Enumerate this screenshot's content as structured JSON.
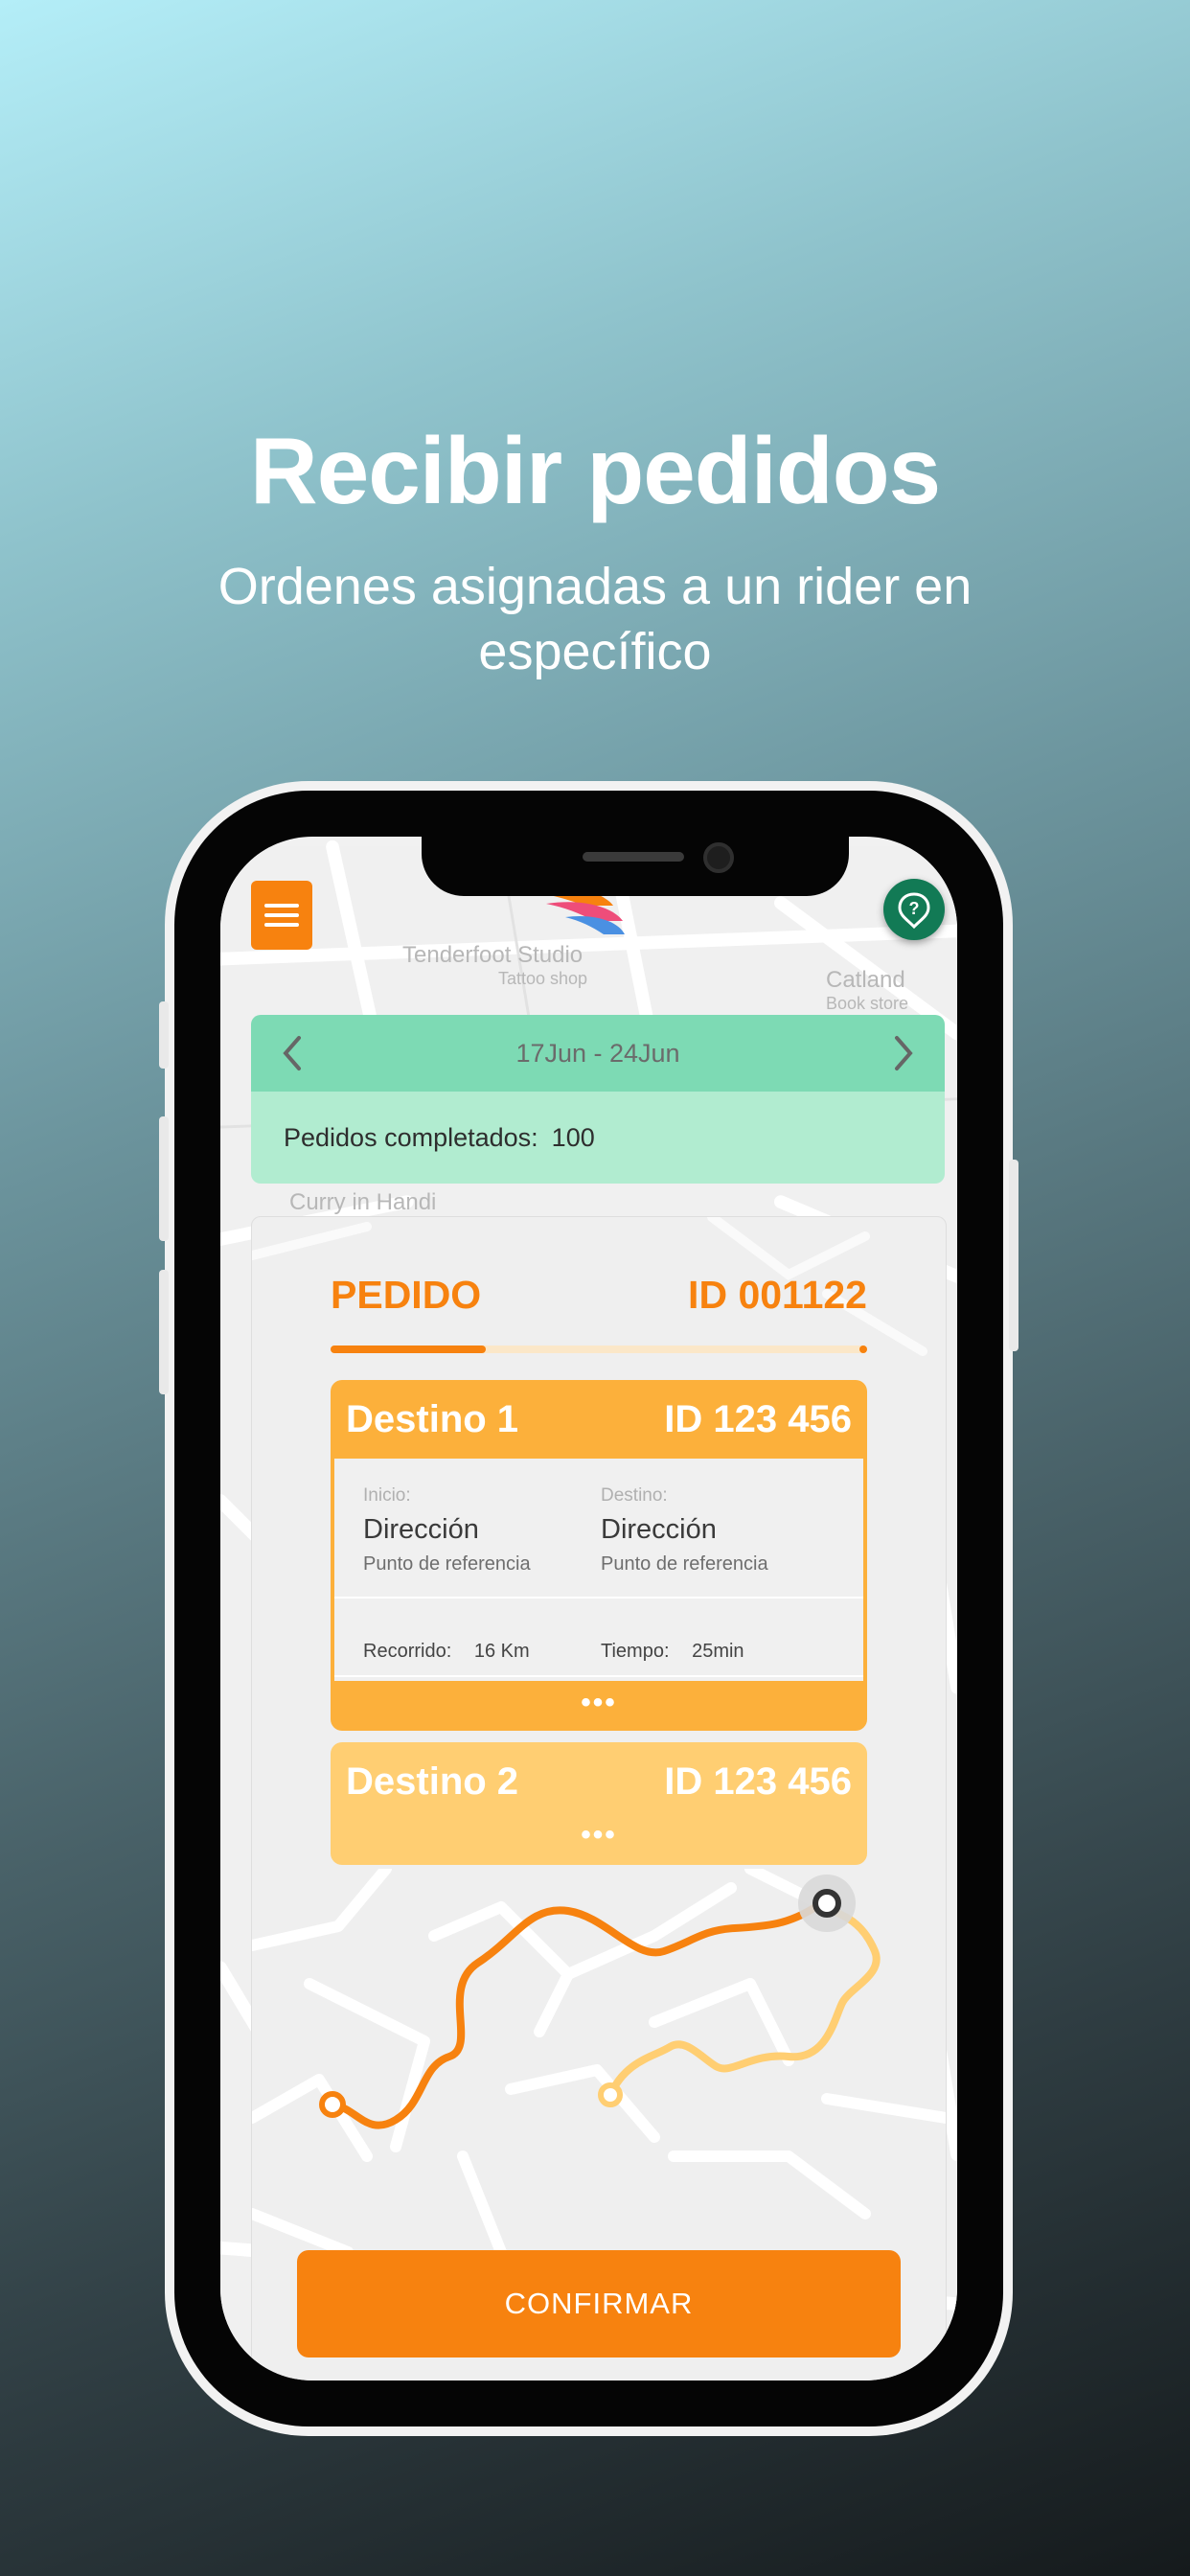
{
  "heading": {
    "title": "Recibir pedidos",
    "subtitle": "Ordenes asignadas a un rider en específico"
  },
  "map_labels": {
    "place1": "Tenderfoot Studio",
    "place1_sub": "Tattoo shop",
    "place2": "Catland",
    "place2_sub": "Book store",
    "place3": "Curry in Handi"
  },
  "week": {
    "range": "17Jun - 24Jun",
    "completed_label": "Pedidos completados:",
    "completed_value": "100"
  },
  "order": {
    "label": "PEDIDO",
    "id": "ID 001122",
    "progress_fraction": 0.29
  },
  "destinations": [
    {
      "name": "Destino 1",
      "id": "ID 123 456",
      "start_label": "Inicio:",
      "start_value": "Dirección",
      "start_ref": "Punto de referencia",
      "end_label": "Destino:",
      "end_value": "Dirección",
      "end_ref": "Punto de referencia",
      "distance_label": "Recorrido:",
      "distance_value": "16 Km",
      "time_label": "Tiempo:",
      "time_value": "25min",
      "more": "•••"
    },
    {
      "name": "Destino 2",
      "id": "ID 123 456",
      "more": "•••"
    }
  ],
  "confirm_label": "CONFIRMAR",
  "icons": {
    "menu": "hamburger-icon",
    "help": "help-icon",
    "prev": "chevron-left-icon",
    "next": "chevron-right-icon",
    "logo": "brand-logo"
  },
  "colors": {
    "accent": "#f7820f",
    "green_header": "#7ddab4",
    "green_body": "#b1ecd0",
    "dest1": "#fcb03b",
    "dest2": "#ffce72",
    "help": "#127a55"
  }
}
